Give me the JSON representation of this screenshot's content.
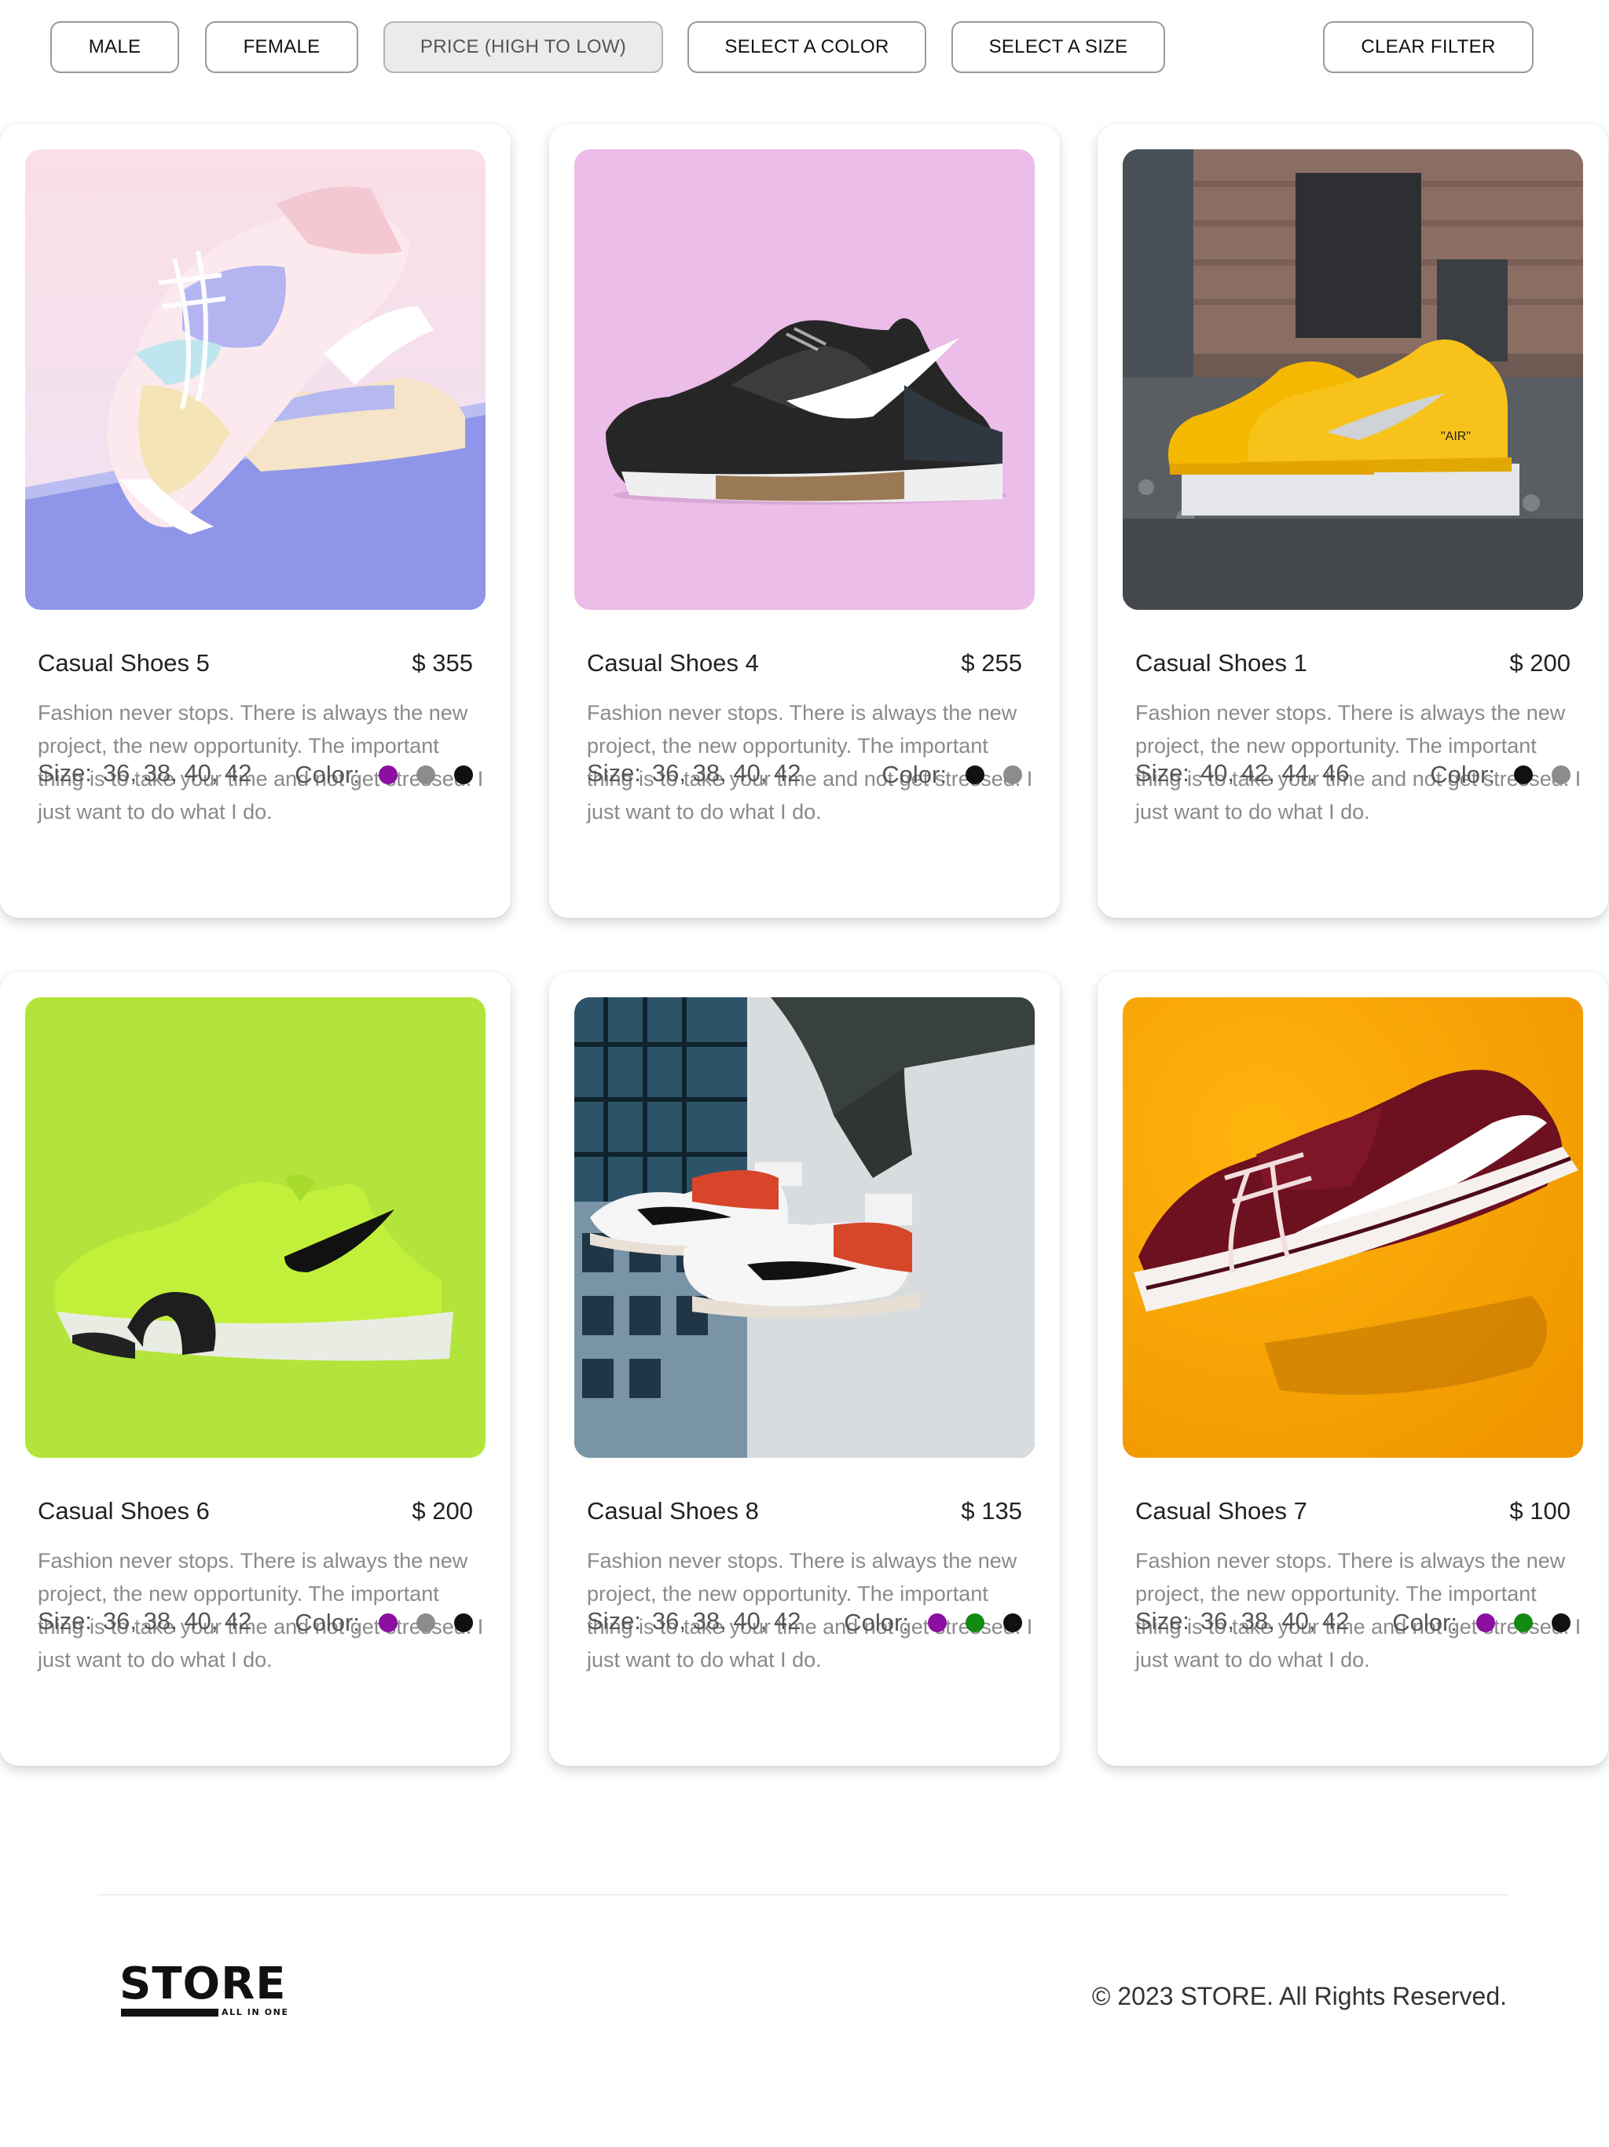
{
  "filters": {
    "male": "MALE",
    "female": "FEMALE",
    "price": "PRICE (HIGH TO LOW)",
    "color": "SELECT A COLOR",
    "size": "SELECT A SIZE",
    "clear": "CLEAR FILTER",
    "active": "price"
  },
  "colors": {
    "purple": "#8b0fa0",
    "gray": "#8c8c8c",
    "black": "#111111",
    "green": "#138a13"
  },
  "products": [
    {
      "name": "Casual Shoes 5",
      "price": "$ 355",
      "image": "pastel-sneaker-photo",
      "description": "Fashion never stops. There is always the new project, the new opportunity. The important thing is to take your time and not get stressed. I just want to do what I do.",
      "size_label": "Size:",
      "sizes": "36, 38, 40, 42",
      "color_label": "Color:",
      "colors": [
        "purple",
        "gray",
        "black"
      ]
    },
    {
      "name": "Casual Shoes 4",
      "price": "$ 255",
      "image": "black-trainer-photo",
      "description": "Fashion never stops. There is always the new project, the new opportunity. The important thing is to take your time and not get stressed. I just want to do what I do.",
      "size_label": "Size:",
      "sizes": "36, 38, 40, 42",
      "color_label": "Color:",
      "colors": [
        "black",
        "gray"
      ]
    },
    {
      "name": "Casual Shoes 1",
      "price": "$ 200",
      "image": "yellow-sneakers-photo",
      "description": "Fashion never stops. There is always the new project, the new opportunity. The important thing is to take your time and not get stressed. I just want to do what I do.",
      "size_label": "Size:",
      "sizes": "40, 42, 44, 46",
      "color_label": "Color:",
      "colors": [
        "black",
        "gray"
      ]
    },
    {
      "name": "Casual Shoes 6",
      "price": "$ 200",
      "image": "lime-runner-photo",
      "description": "Fashion never stops. There is always the new project, the new opportunity. The important thing is to take your time and not get stressed. I just want to do what I do.",
      "size_label": "Size:",
      "sizes": "36, 38, 40, 42",
      "color_label": "Color:",
      "colors": [
        "purple",
        "gray",
        "black"
      ]
    },
    {
      "name": "Casual Shoes 8",
      "price": "$ 135",
      "image": "feet-sneakers-photo",
      "description": "Fashion never stops. There is always the new project, the new opportunity. The important thing is to take your time and not get stressed. I just want to do what I do.",
      "size_label": "Size:",
      "sizes": "36, 38, 40, 42",
      "color_label": "Color:",
      "colors": [
        "purple",
        "green",
        "black"
      ]
    },
    {
      "name": "Casual Shoes 7",
      "price": "$ 100",
      "image": "maroon-skate-shoe-photo",
      "description": "Fashion never stops. There is always the new project, the new opportunity. The important thing is to take your time and not get stressed. I just want to do what I do.",
      "size_label": "Size:",
      "sizes": "36, 38, 40, 42",
      "color_label": "Color:",
      "colors": [
        "purple",
        "green",
        "black"
      ]
    }
  ],
  "footer": {
    "logo_text": "STORE",
    "logo_tagline": "ALL IN ONE",
    "copyright": "© 2023 STORE. All Rights Reserved."
  }
}
